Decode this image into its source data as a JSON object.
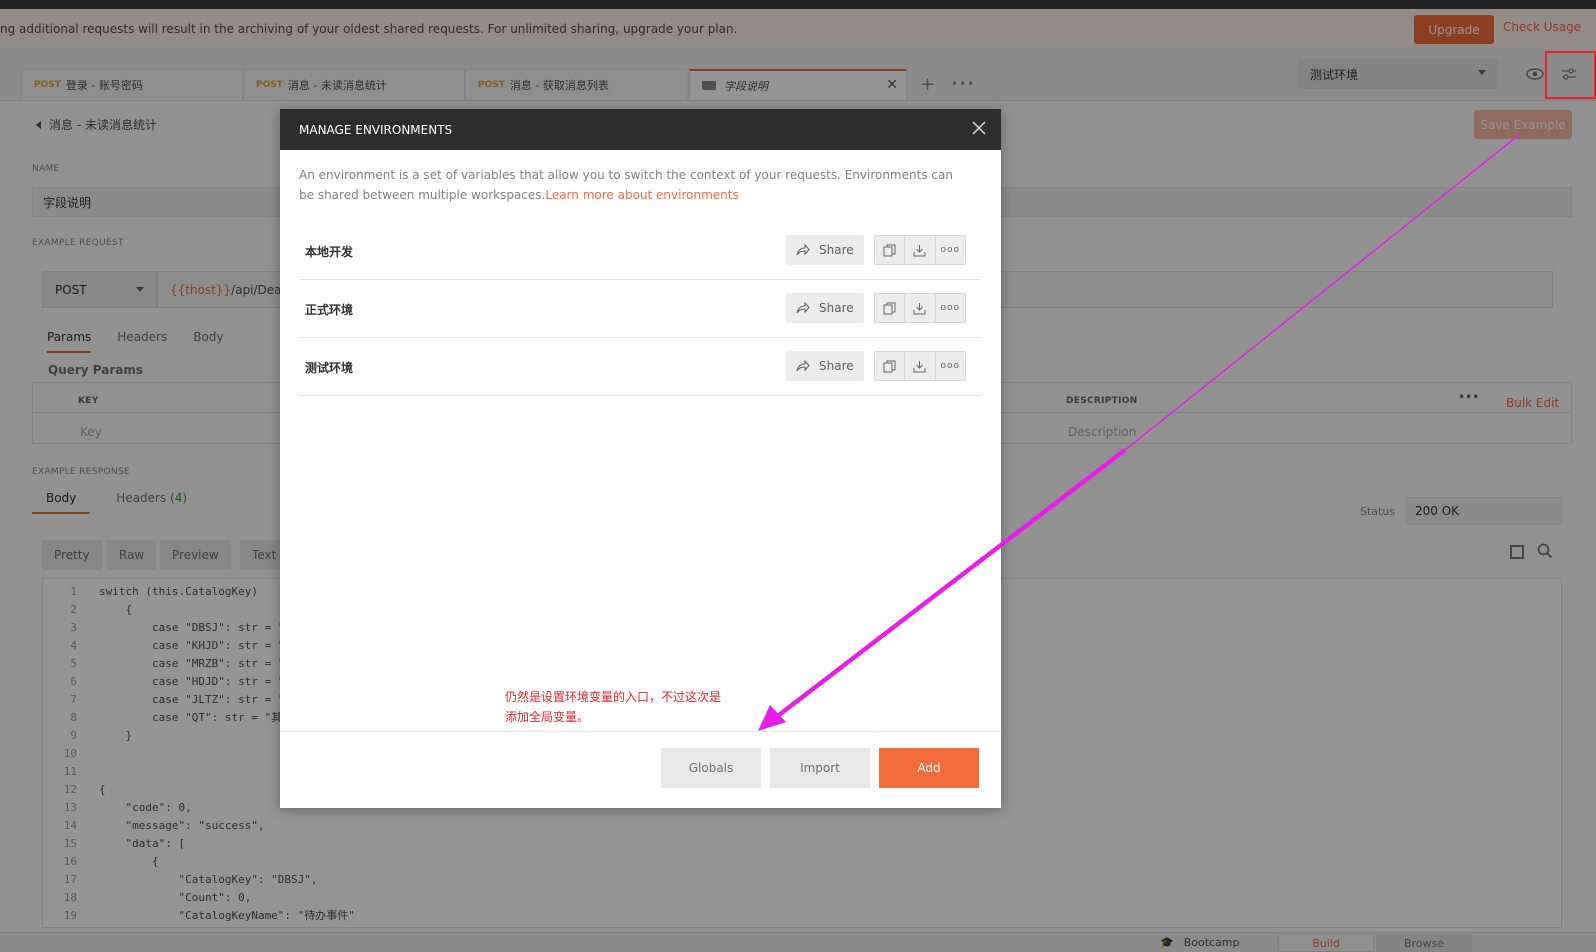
{
  "banner": {
    "text": "ng additional requests will result in the archiving of your oldest shared requests. For unlimited sharing, upgrade your plan.",
    "upgrade_label": "Upgrade",
    "check_usage_label": "Check Usage"
  },
  "tabs": [
    {
      "method": "POST",
      "label": "登录 - 账号密码"
    },
    {
      "method": "POST",
      "label": "消息 - 未读消息统计"
    },
    {
      "method": "POST",
      "label": "消息 - 获取消息列表"
    },
    {
      "method": "",
      "label": "字段说明"
    }
  ],
  "environment": {
    "selected": "测试环境"
  },
  "page": {
    "breadcrumb": "消息 - 未读消息统计",
    "save_example_label": "Save Example",
    "name_label": "NAME",
    "name_value": "字段说明",
    "example_request_label": "EXAMPLE REQUEST",
    "method": "POST",
    "url_var": "{{thost}}",
    "url_rest": "/api/Dealer",
    "request_tabs": [
      "Params",
      "Headers",
      "Body"
    ],
    "query_params_label": "Query Params",
    "col_key": "KEY",
    "col_description": "DESCRIPTION",
    "bulk_edit_label": "Bulk Edit",
    "key_placeholder": "Key",
    "description_placeholder": "Description",
    "example_response_label": "EXAMPLE RESPONSE",
    "response_tab_body": "Body",
    "response_tab_headers": "Headers",
    "response_headers_count": "(4)",
    "status_label": "Status",
    "status_value": "200 OK",
    "format_buttons": [
      "Pretty",
      "Raw",
      "Preview",
      "Text"
    ]
  },
  "code_lines": [
    {
      "n": "1",
      "text": "switch (this.CatalogKey)"
    },
    {
      "n": "2",
      "text": "    {"
    },
    {
      "n": "3",
      "text": "        case \"DBSJ\": str = \""
    },
    {
      "n": "4",
      "text": "        case \"KHJD\": str = \""
    },
    {
      "n": "5",
      "text": "        case \"MRZB\": str = \""
    },
    {
      "n": "6",
      "text": "        case \"HDJD\": str = \""
    },
    {
      "n": "7",
      "text": "        case \"JLTZ\": str = \""
    },
    {
      "n": "8",
      "text": "        case \"QT\": str = \"其"
    },
    {
      "n": "9",
      "text": "    }"
    },
    {
      "n": "10",
      "text": ""
    },
    {
      "n": "11",
      "text": ""
    },
    {
      "n": "12",
      "text": "{"
    },
    {
      "n": "13",
      "text": "    \"code\": 0,"
    },
    {
      "n": "14",
      "text": "    \"message\": \"success\","
    },
    {
      "n": "15",
      "text": "    \"data\": ["
    },
    {
      "n": "16",
      "text": "        {"
    },
    {
      "n": "17",
      "text": "            \"CatalogKey\": \"DBSJ\","
    },
    {
      "n": "18",
      "text": "            \"Count\": 0,"
    },
    {
      "n": "19",
      "text": "            \"CatalogKeyName\": \"待办事件\""
    }
  ],
  "footer": {
    "bootcamp_label": "Bootcamp",
    "build_label": "Build",
    "browse_label": "Browse"
  },
  "modal": {
    "title": "MANAGE ENVIRONMENTS",
    "description": "An environment is a set of variables that allow you to switch the context of your requests. Environments can be shared between multiple workspaces.",
    "learn_more": "Learn more about environments",
    "environments": [
      {
        "name": "本地开发"
      },
      {
        "name": "正式环境"
      },
      {
        "name": "测试环境"
      }
    ],
    "share_label": "Share",
    "annotation_line1": "仍然是设置环境变量的入口，不过这次是",
    "annotation_line2": "添加全局变量。",
    "globals_label": "Globals",
    "import_label": "Import",
    "add_label": "Add"
  },
  "colors": {
    "accent": "#f26b3a",
    "annotation_red": "#e8222a",
    "arrow_magenta": "#e81ee8",
    "modal_header": "#2d2d2d"
  }
}
